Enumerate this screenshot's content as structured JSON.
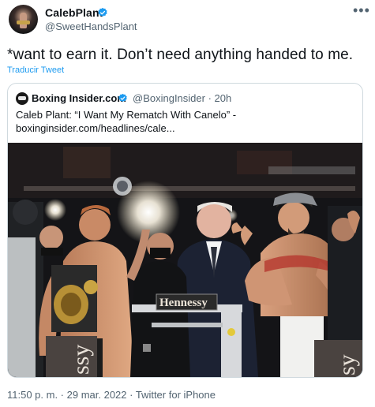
{
  "author": {
    "display_name": "CalebPlant",
    "handle": "@SweetHandsPlant",
    "verified": true,
    "avatar_icon": "avatar-boxer-photo"
  },
  "more_icon": "more-horizontal-icon",
  "tweet": {
    "text": "*want to earn it. Don’t need anything handed to me.",
    "translate_label": "Traducir Tweet"
  },
  "quoted_tweet": {
    "display_name": "Boxing Insider.com",
    "handle_time": "@BoxingInsider · 20h",
    "text": "Caleb Plant: “I Want My Rematch With Canelo” - boxinginsider.com/headlines/cale...",
    "verified": true,
    "image": {
      "scene_banner": "Hennessy",
      "left_banner": "ssy",
      "right_banner": "sy"
    }
  },
  "footer": {
    "meta": "11:50 p. m. · 29 mar. 2022 · Twitter for iPhone"
  },
  "colors": {
    "verified": "#1d9bf0",
    "link": "#1d9bf0",
    "secondary_text": "#536471",
    "border": "#cfd9de"
  }
}
